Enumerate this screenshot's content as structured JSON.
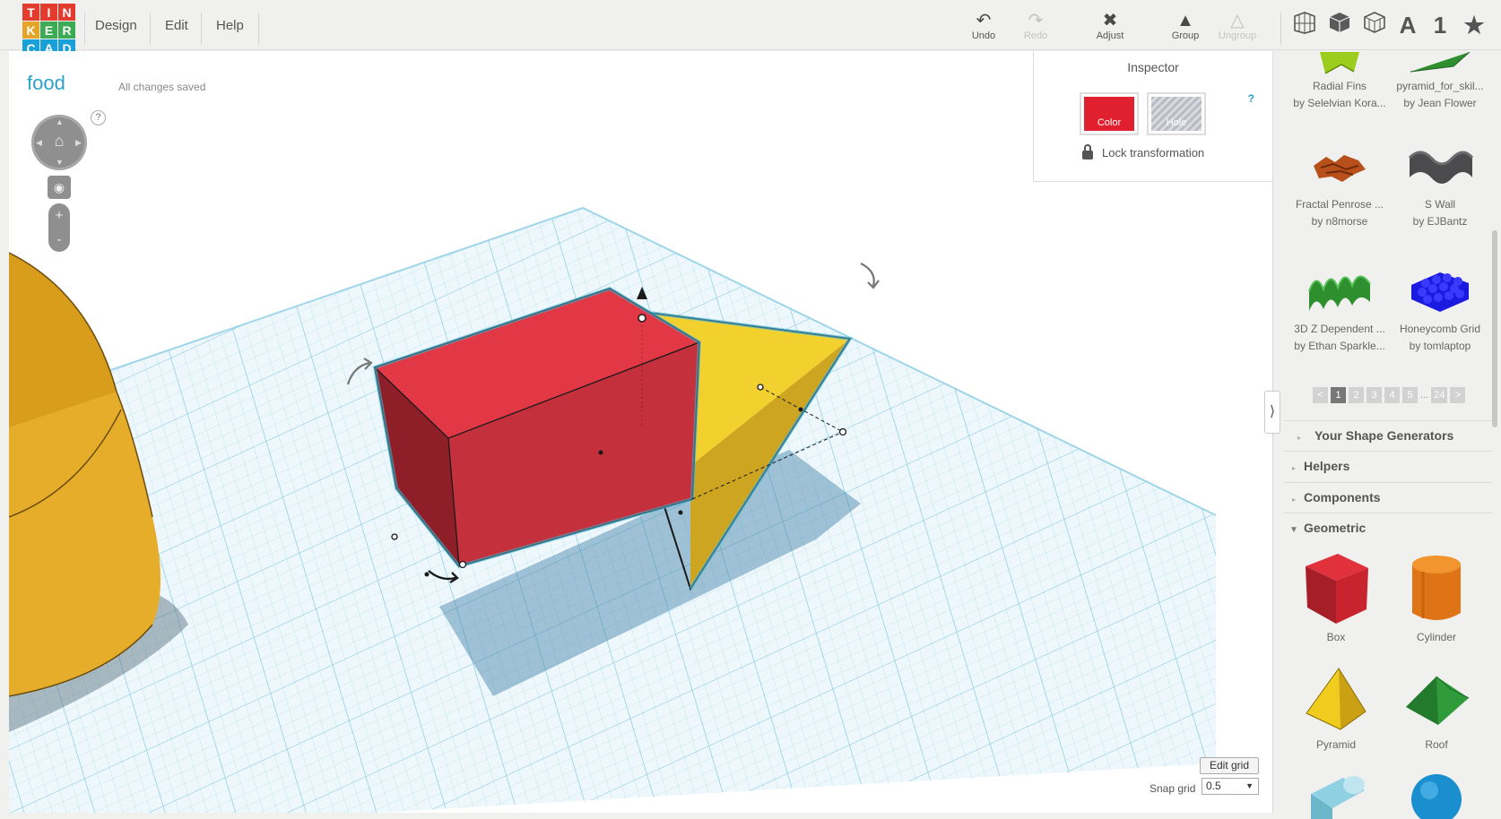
{
  "logo": {
    "letters": [
      "T",
      "I",
      "N",
      "K",
      "E",
      "R",
      "C",
      "A",
      "D"
    ],
    "colors": [
      "#e33b2e",
      "#e33b2e",
      "#e33b2e",
      "#e3a427",
      "#3daa55",
      "#3daa55",
      "#1aa0d8",
      "#1aa0d8",
      "#1aa0d8"
    ]
  },
  "menu": {
    "items": [
      "Design",
      "Edit",
      "Help"
    ]
  },
  "toolbar": {
    "undo": "Undo",
    "redo": "Redo",
    "adjust": "Adjust",
    "group": "Group",
    "ungroup": "Ungroup",
    "view_text": "A",
    "view_number": "1"
  },
  "project": {
    "title": "food",
    "status": "All changes saved"
  },
  "nav": {
    "help": "?",
    "zoom_in": "+",
    "zoom_out": "-"
  },
  "inspector": {
    "title": "Inspector",
    "help": "?",
    "color_label": "Color",
    "hole_label": "Hole",
    "lock_label": "Lock transformation",
    "color_value": "#e0202e"
  },
  "grid": {
    "edit_label": "Edit grid",
    "snap_label": "Snap grid",
    "snap_value": "0.5"
  },
  "sidebar": {
    "community_shapes": [
      {
        "name": "Radial Fins",
        "author": "by Selelvian Kora..."
      },
      {
        "name": "pyramid_for_skil...",
        "author": "by Jean Flower"
      },
      {
        "name": "Fractal Penrose ...",
        "author": "by n8morse"
      },
      {
        "name": "S Wall",
        "author": "by EJBantz"
      },
      {
        "name": "3D Z Dependent ...",
        "author": "by Ethan Sparkle..."
      },
      {
        "name": "Honeycomb Grid",
        "author": "by tomlaptop"
      }
    ],
    "pager": {
      "prev": "<",
      "pages": [
        "1",
        "2",
        "3",
        "4",
        "5"
      ],
      "ellipsis": "...",
      "last": "24",
      "next": ">"
    },
    "sections": [
      "Your Shape Generators",
      "Helpers",
      "Components",
      "Geometric"
    ],
    "geometric": [
      "Box",
      "Cylinder",
      "Pyramid",
      "Roof"
    ]
  },
  "collapse_glyph": "⟩"
}
